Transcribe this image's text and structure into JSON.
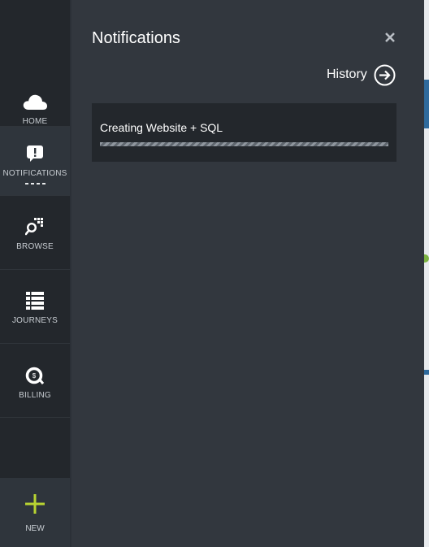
{
  "sidebar": {
    "items": [
      {
        "label": "HOME",
        "icon": "cloud-icon"
      },
      {
        "label": "NOTIFICATIONS",
        "icon": "alert-icon"
      },
      {
        "label": "BROWSE",
        "icon": "browse-icon"
      },
      {
        "label": "JOURNEYS",
        "icon": "journeys-icon"
      },
      {
        "label": "BILLING",
        "icon": "billing-icon"
      }
    ],
    "new_label": "NEW"
  },
  "panel": {
    "title": "Notifications",
    "history_label": "History",
    "notifications": [
      {
        "text": "Creating Website + SQL",
        "status": "in-progress"
      }
    ]
  },
  "colors": {
    "sidebar_bg": "#23272c",
    "panel_bg": "#32373e",
    "new_accent": "#b8d432"
  }
}
